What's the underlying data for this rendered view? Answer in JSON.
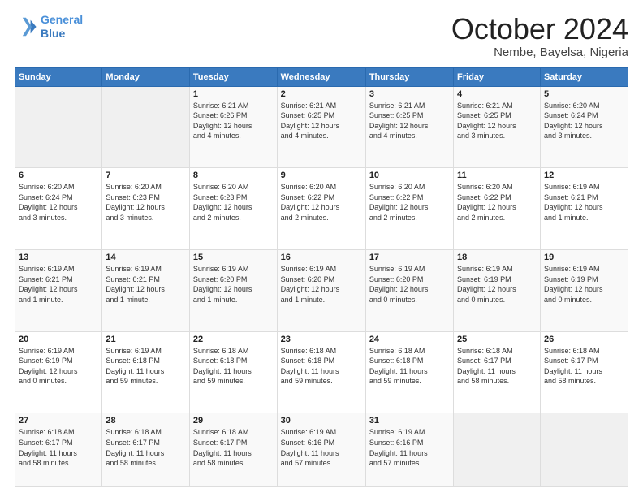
{
  "header": {
    "logo_line1": "General",
    "logo_line2": "Blue",
    "title": "October 2024",
    "subtitle": "Nembe, Bayelsa, Nigeria"
  },
  "days_of_week": [
    "Sunday",
    "Monday",
    "Tuesday",
    "Wednesday",
    "Thursday",
    "Friday",
    "Saturday"
  ],
  "weeks": [
    [
      {
        "day": "",
        "info": ""
      },
      {
        "day": "",
        "info": ""
      },
      {
        "day": "1",
        "info": "Sunrise: 6:21 AM\nSunset: 6:26 PM\nDaylight: 12 hours\nand 4 minutes."
      },
      {
        "day": "2",
        "info": "Sunrise: 6:21 AM\nSunset: 6:25 PM\nDaylight: 12 hours\nand 4 minutes."
      },
      {
        "day": "3",
        "info": "Sunrise: 6:21 AM\nSunset: 6:25 PM\nDaylight: 12 hours\nand 4 minutes."
      },
      {
        "day": "4",
        "info": "Sunrise: 6:21 AM\nSunset: 6:25 PM\nDaylight: 12 hours\nand 3 minutes."
      },
      {
        "day": "5",
        "info": "Sunrise: 6:20 AM\nSunset: 6:24 PM\nDaylight: 12 hours\nand 3 minutes."
      }
    ],
    [
      {
        "day": "6",
        "info": "Sunrise: 6:20 AM\nSunset: 6:24 PM\nDaylight: 12 hours\nand 3 minutes."
      },
      {
        "day": "7",
        "info": "Sunrise: 6:20 AM\nSunset: 6:23 PM\nDaylight: 12 hours\nand 3 minutes."
      },
      {
        "day": "8",
        "info": "Sunrise: 6:20 AM\nSunset: 6:23 PM\nDaylight: 12 hours\nand 2 minutes."
      },
      {
        "day": "9",
        "info": "Sunrise: 6:20 AM\nSunset: 6:22 PM\nDaylight: 12 hours\nand 2 minutes."
      },
      {
        "day": "10",
        "info": "Sunrise: 6:20 AM\nSunset: 6:22 PM\nDaylight: 12 hours\nand 2 minutes."
      },
      {
        "day": "11",
        "info": "Sunrise: 6:20 AM\nSunset: 6:22 PM\nDaylight: 12 hours\nand 2 minutes."
      },
      {
        "day": "12",
        "info": "Sunrise: 6:19 AM\nSunset: 6:21 PM\nDaylight: 12 hours\nand 1 minute."
      }
    ],
    [
      {
        "day": "13",
        "info": "Sunrise: 6:19 AM\nSunset: 6:21 PM\nDaylight: 12 hours\nand 1 minute."
      },
      {
        "day": "14",
        "info": "Sunrise: 6:19 AM\nSunset: 6:21 PM\nDaylight: 12 hours\nand 1 minute."
      },
      {
        "day": "15",
        "info": "Sunrise: 6:19 AM\nSunset: 6:20 PM\nDaylight: 12 hours\nand 1 minute."
      },
      {
        "day": "16",
        "info": "Sunrise: 6:19 AM\nSunset: 6:20 PM\nDaylight: 12 hours\nand 1 minute."
      },
      {
        "day": "17",
        "info": "Sunrise: 6:19 AM\nSunset: 6:20 PM\nDaylight: 12 hours\nand 0 minutes."
      },
      {
        "day": "18",
        "info": "Sunrise: 6:19 AM\nSunset: 6:19 PM\nDaylight: 12 hours\nand 0 minutes."
      },
      {
        "day": "19",
        "info": "Sunrise: 6:19 AM\nSunset: 6:19 PM\nDaylight: 12 hours\nand 0 minutes."
      }
    ],
    [
      {
        "day": "20",
        "info": "Sunrise: 6:19 AM\nSunset: 6:19 PM\nDaylight: 12 hours\nand 0 minutes."
      },
      {
        "day": "21",
        "info": "Sunrise: 6:19 AM\nSunset: 6:18 PM\nDaylight: 11 hours\nand 59 minutes."
      },
      {
        "day": "22",
        "info": "Sunrise: 6:18 AM\nSunset: 6:18 PM\nDaylight: 11 hours\nand 59 minutes."
      },
      {
        "day": "23",
        "info": "Sunrise: 6:18 AM\nSunset: 6:18 PM\nDaylight: 11 hours\nand 59 minutes."
      },
      {
        "day": "24",
        "info": "Sunrise: 6:18 AM\nSunset: 6:18 PM\nDaylight: 11 hours\nand 59 minutes."
      },
      {
        "day": "25",
        "info": "Sunrise: 6:18 AM\nSunset: 6:17 PM\nDaylight: 11 hours\nand 58 minutes."
      },
      {
        "day": "26",
        "info": "Sunrise: 6:18 AM\nSunset: 6:17 PM\nDaylight: 11 hours\nand 58 minutes."
      }
    ],
    [
      {
        "day": "27",
        "info": "Sunrise: 6:18 AM\nSunset: 6:17 PM\nDaylight: 11 hours\nand 58 minutes."
      },
      {
        "day": "28",
        "info": "Sunrise: 6:18 AM\nSunset: 6:17 PM\nDaylight: 11 hours\nand 58 minutes."
      },
      {
        "day": "29",
        "info": "Sunrise: 6:18 AM\nSunset: 6:17 PM\nDaylight: 11 hours\nand 58 minutes."
      },
      {
        "day": "30",
        "info": "Sunrise: 6:19 AM\nSunset: 6:16 PM\nDaylight: 11 hours\nand 57 minutes."
      },
      {
        "day": "31",
        "info": "Sunrise: 6:19 AM\nSunset: 6:16 PM\nDaylight: 11 hours\nand 57 minutes."
      },
      {
        "day": "",
        "info": ""
      },
      {
        "day": "",
        "info": ""
      }
    ]
  ]
}
